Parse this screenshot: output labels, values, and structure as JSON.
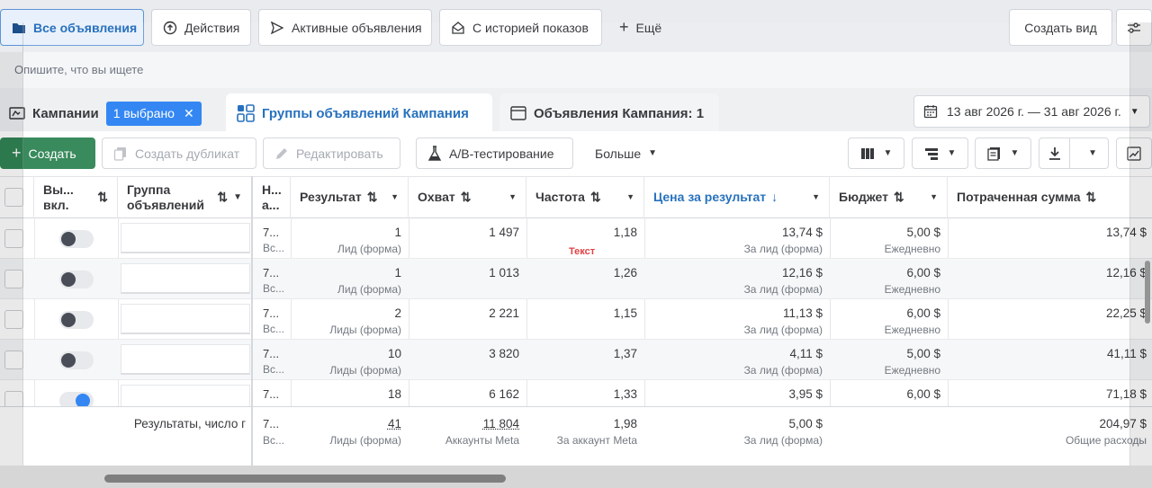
{
  "views": {
    "all_ads": "Все объявления",
    "actions": "Действия",
    "active_ads": "Активные объявления",
    "with_history": "С историей показов",
    "more": "Ещё",
    "create_view": "Создать вид"
  },
  "search": {
    "placeholder": "Опишите, что вы ищете"
  },
  "tabs": {
    "campaigns": "Кампании",
    "selected_pill": "1 выбрано",
    "ad_sets": "Группы объявлений Кампания",
    "ads": "Объявления Кампания: 1"
  },
  "date_range": "13 авг 2026 г. — 31 авг 2026 г.",
  "toolbar": {
    "create": "Создать",
    "duplicate": "Создать дубликат",
    "edit": "Редактировать",
    "ab_test": "A/B-тестирование",
    "more": "Больше"
  },
  "columns": {
    "on_off": "Вы... вкл.",
    "on_off_l1": "Вы...",
    "on_off_l2": "вкл.",
    "name_l1": "Группа",
    "name_l2": "объявлений",
    "n_l1": "Н...",
    "n_l2": "а...",
    "result": "Результат",
    "reach": "Охват",
    "frequency": "Частота",
    "cost_per_result": "Цена за результат",
    "budget": "Бюджет",
    "spent": "Потраченная сумма"
  },
  "rows": [
    {
      "on": false,
      "n": "7...",
      "n_sub": "Вс...",
      "result": "1",
      "result_sub": "Лид (форма)",
      "reach": "1 497",
      "freq": "1,18",
      "cpr": "13,74 $",
      "cpr_sub": "За лид (форма)",
      "budget": "5,00 $",
      "budget_sub": "Ежедневно",
      "spent": "13,74 $"
    },
    {
      "on": false,
      "n": "7...",
      "n_sub": "Вс...",
      "result": "1",
      "result_sub": "Лид (форма)",
      "reach": "1 013",
      "freq": "1,26",
      "cpr": "12,16 $",
      "cpr_sub": "За лид (форма)",
      "budget": "6,00 $",
      "budget_sub": "Ежедневно",
      "spent": "12,16 $"
    },
    {
      "on": false,
      "n": "7...",
      "n_sub": "Вс...",
      "result": "2",
      "result_sub": "Лиды (форма)",
      "reach": "2 221",
      "freq": "1,15",
      "cpr": "11,13 $",
      "cpr_sub": "За лид (форма)",
      "budget": "6,00 $",
      "budget_sub": "Ежедневно",
      "spent": "22,25 $"
    },
    {
      "on": false,
      "n": "7...",
      "n_sub": "Вс...",
      "result": "10",
      "result_sub": "Лиды (форма)",
      "reach": "3 820",
      "freq": "1,37",
      "cpr": "4,11 $",
      "cpr_sub": "За лид (форма)",
      "budget": "5,00 $",
      "budget_sub": "Ежедневно",
      "spent": "41,11 $"
    },
    {
      "on": true,
      "n": "7...",
      "n_sub": "Вс...",
      "result": "18",
      "result_sub": "",
      "reach": "6 162",
      "freq": "1,33",
      "cpr": "3,95 $",
      "cpr_sub": "",
      "budget": "6,00 $",
      "budget_sub": "",
      "spent": "71,18 $"
    }
  ],
  "overlay_label": "Текст",
  "footer": {
    "label": "Результаты, число г",
    "n": "7...",
    "n_sub": "Вс...",
    "result": "41",
    "result_sub": "Лиды (форма)",
    "reach": "11 804",
    "reach_sub": "Аккаунты Meta",
    "freq": "1,98",
    "freq_sub": "За аккаунт Meta",
    "cpr": "5,00 $",
    "cpr_sub": "За лид (форма)",
    "spent": "204,97 $",
    "spent_sub": "Общие расходы"
  },
  "colors": {
    "accent": "#1877f2",
    "create_green": "#1e7a47",
    "link_blue": "#0a5eb5",
    "overlay_red": "#e0262b"
  }
}
